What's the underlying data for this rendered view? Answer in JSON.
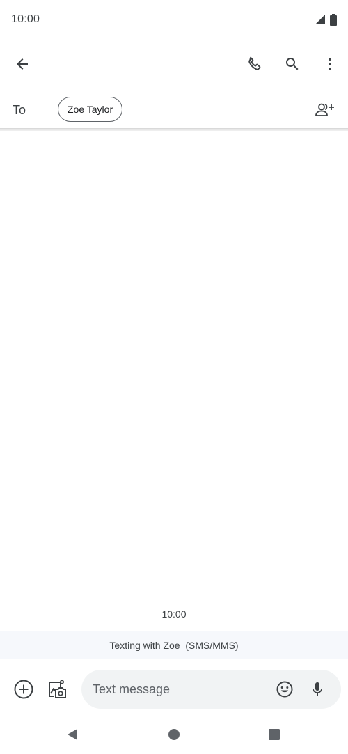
{
  "status_bar": {
    "time": "10:00",
    "icons": [
      "cell-signal-icon",
      "battery-icon"
    ]
  },
  "app_bar": {
    "actions": [
      "back-arrow-icon",
      "phone-icon",
      "search-icon",
      "more-vert-icon"
    ]
  },
  "recipients": {
    "to_label": "To",
    "chips": [
      {
        "name": "Zoe Taylor"
      }
    ]
  },
  "conversation": {
    "timestamp": "10:00",
    "banner": "Texting with Zoe  (SMS/MMS)"
  },
  "compose": {
    "placeholder": "Text message",
    "value": ""
  },
  "nav_bar": {
    "buttons": [
      "nav-back-icon",
      "nav-home-icon",
      "nav-recents-icon"
    ]
  },
  "colors": {
    "icon": "#3c4043",
    "banner_bg": "#f6f8fc",
    "field_bg": "#f1f3f4",
    "nav_icon": "#5f6368"
  }
}
